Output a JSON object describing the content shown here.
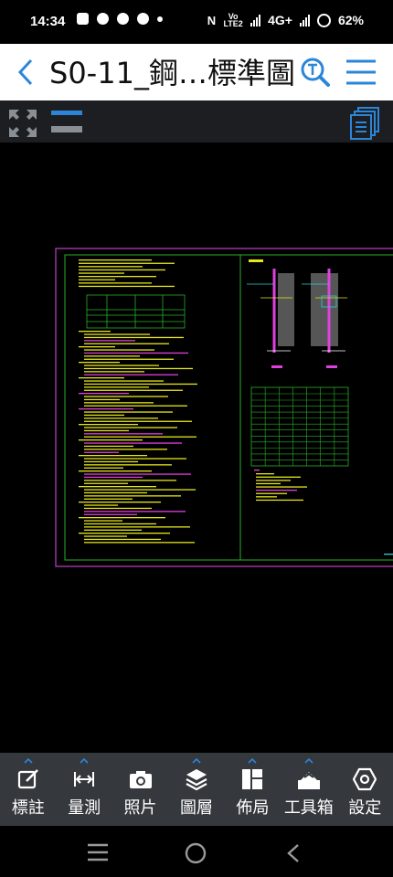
{
  "status_bar": {
    "time": "14:34",
    "network_volte": "Vo LTE2",
    "network_type": "4G+",
    "battery": "62%"
  },
  "header": {
    "title": "S0-11_鋼…標準圖",
    "search_icon": "search-text-icon",
    "menu_icon": "hamburger-menu-icon"
  },
  "colors": {
    "accent": "#2b86d9",
    "header_bg": "#ffffff",
    "viewer_toolbar_bg": "#1c1e22",
    "bottom_toolbar_bg": "#35383d",
    "sheet_border": "#c040c8",
    "frame_green": "#2ab02a",
    "text_yellow": "#e6e61a",
    "text_magenta": "#e040e0",
    "text_cyan": "#30d0d0"
  },
  "bottom_toolbar": {
    "items": [
      {
        "label": "標註",
        "icon": "annotate-icon"
      },
      {
        "label": "量測",
        "icon": "measure-icon"
      },
      {
        "label": "照片",
        "icon": "camera-icon"
      },
      {
        "label": "圖層",
        "icon": "layers-icon"
      },
      {
        "label": "佈局",
        "icon": "layout-icon"
      },
      {
        "label": "工具箱",
        "icon": "toolbox-icon"
      },
      {
        "label": "設定",
        "icon": "settings-icon"
      }
    ]
  }
}
